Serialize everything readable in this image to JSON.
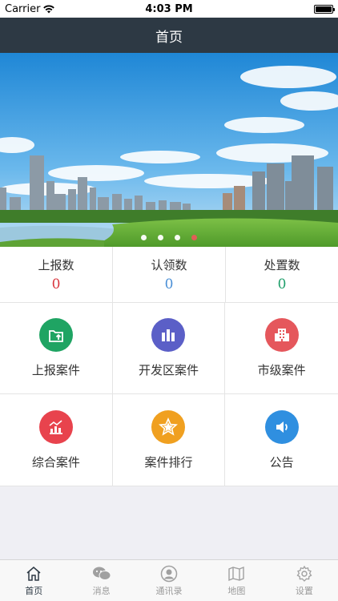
{
  "status_bar": {
    "carrier": "Carrier",
    "time": "4:03 PM"
  },
  "nav": {
    "title": "首页"
  },
  "banner": {
    "active_index": 3,
    "slides": 4
  },
  "stats": [
    {
      "label": "上报数",
      "value": "0",
      "color": "#d9363e"
    },
    {
      "label": "认领数",
      "value": "0",
      "color": "#4a8fd6"
    },
    {
      "label": "处置数",
      "value": "0",
      "color": "#1e9e6a"
    }
  ],
  "grid": [
    {
      "label": "上报案件",
      "icon": "report-case-icon",
      "color": "#1fa463"
    },
    {
      "label": "开发区案件",
      "icon": "dev-zone-icon",
      "color": "#5b5fc7"
    },
    {
      "label": "市级案件",
      "icon": "city-building-icon",
      "color": "#e5575c"
    },
    {
      "label": "综合案件",
      "icon": "chart-icon",
      "color": "#e8434d"
    },
    {
      "label": "案件排行",
      "icon": "star-rank-icon",
      "color": "#f0a020"
    },
    {
      "label": "公告",
      "icon": "speaker-icon",
      "color": "#2f8fe0"
    }
  ],
  "tabs": [
    {
      "label": "首页",
      "icon": "home-icon",
      "active": true
    },
    {
      "label": "消息",
      "icon": "message-icon",
      "active": false
    },
    {
      "label": "通讯录",
      "icon": "contacts-icon",
      "active": false
    },
    {
      "label": "地图",
      "icon": "map-icon",
      "active": false
    },
    {
      "label": "设置",
      "icon": "settings-icon",
      "active": false
    }
  ]
}
